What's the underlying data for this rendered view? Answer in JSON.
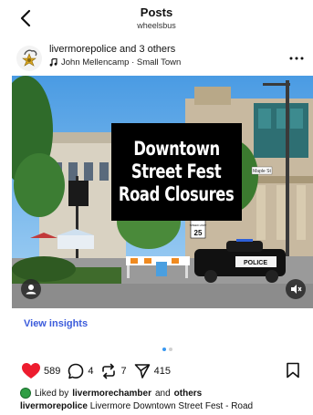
{
  "header": {
    "title": "Posts",
    "subtitle": "wheelsbus"
  },
  "post": {
    "author": "livermorepolice",
    "coauthors_suffix": " and 3 others",
    "music": "John Mellencamp · Small Town",
    "media_overlay": {
      "line1": "Downtown",
      "line2": "Street Fest",
      "line3": "Road Closures"
    },
    "scene_text": {
      "street_sign": "Maple St",
      "speed_sign_top": "SPEED LIMIT",
      "speed_sign_value": "25",
      "police_text": "POLICE"
    },
    "insights_label": "View insights",
    "carousel": {
      "count": 2,
      "active": 0
    },
    "stats": {
      "likes": "589",
      "comments": "4",
      "reposts": "7",
      "shares": "415"
    },
    "liked_by": {
      "prefix": "Liked by ",
      "user": "livermorechamber",
      "middle": " and ",
      "others": "others"
    },
    "caption": {
      "author": "livermorepolice",
      "text": " Livermore Downtown Street Fest - Road"
    }
  },
  "colors": {
    "heart": "#ed1c2e",
    "insights": "#3b5bdb",
    "carousel_active": "#3897f0",
    "overlay_bg": "#000000"
  },
  "icons": {
    "back": "chevron-left-icon",
    "more": "more-horizontal-icon",
    "music": "music-note-icon",
    "like": "heart-filled-icon",
    "comment": "comment-bubble-icon",
    "repost": "repost-arrows-icon",
    "share": "paper-plane-icon",
    "save": "bookmark-icon",
    "user_tag": "user-tag-icon",
    "mute": "speaker-muted-icon"
  }
}
